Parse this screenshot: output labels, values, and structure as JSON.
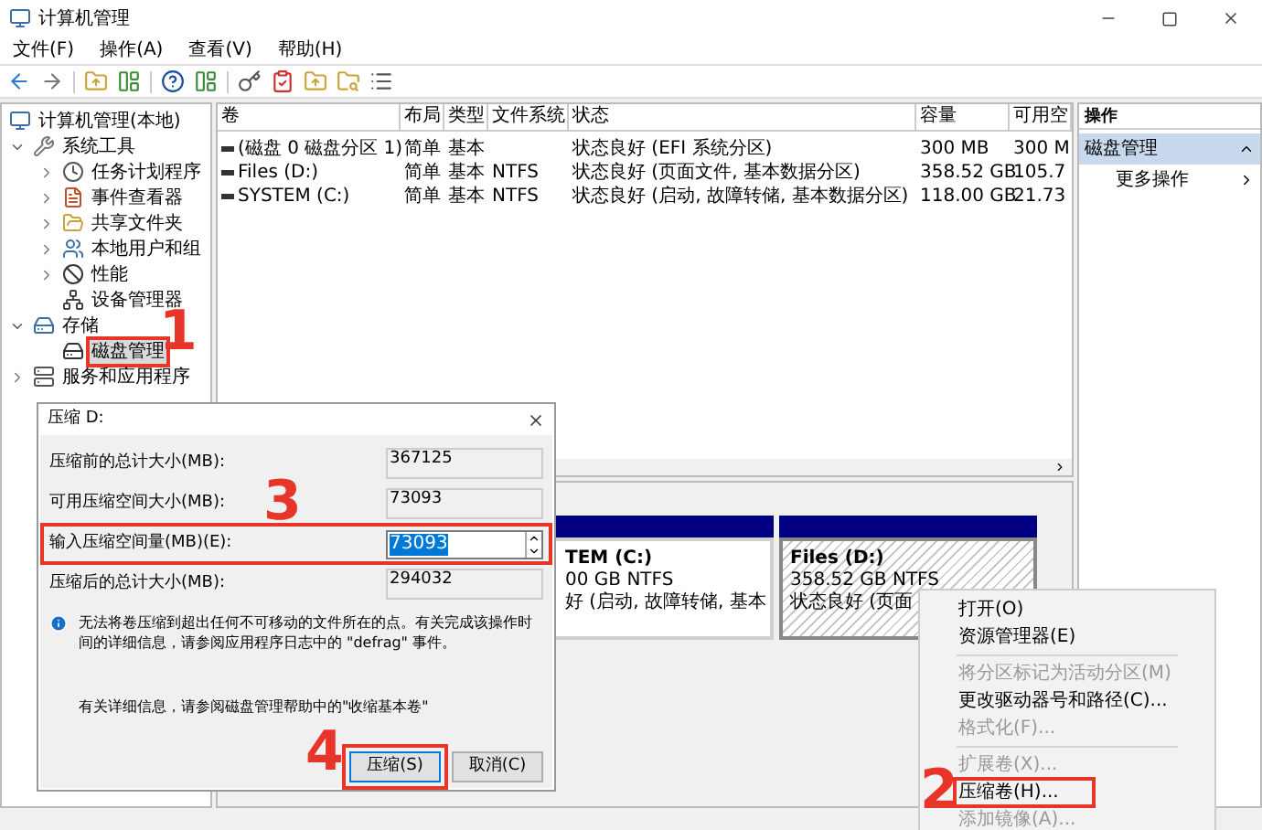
{
  "window": {
    "title": "计算机管理"
  },
  "menu": [
    "文件(F)",
    "操作(A)",
    "查看(V)",
    "帮助(H)"
  ],
  "tree": [
    {
      "label": "计算机管理(本地)",
      "selected": false,
      "children": [
        {
          "label": "系统工具",
          "selected": false,
          "expanded": true,
          "children": [
            {
              "label": "任务计划程序",
              "selected": false,
              "expanded": false
            },
            {
              "label": "事件查看器",
              "selected": false,
              "expanded": false
            },
            {
              "label": "共享文件夹",
              "selected": false,
              "expanded": false
            },
            {
              "label": "本地用户和组",
              "selected": false,
              "expanded": false
            },
            {
              "label": "性能",
              "selected": false,
              "expanded": false
            },
            {
              "label": "设备管理器",
              "selected": false
            }
          ]
        },
        {
          "label": "存储",
          "selected": false,
          "expanded": true,
          "children": [
            {
              "label": "磁盘管理",
              "selected": true,
              "step": "1"
            }
          ]
        },
        {
          "label": "服务和应用程序",
          "selected": false,
          "expanded": false
        }
      ]
    }
  ],
  "table": {
    "columns": [
      "卷",
      "布局",
      "类型",
      "文件系统",
      "状态",
      "容量",
      "可用空"
    ],
    "rows": [
      [
        "(磁盘 0 磁盘分区 1)",
        "简单",
        "基本",
        "",
        "状态良好 (EFI 系统分区)",
        "300 MB",
        "300 M"
      ],
      [
        "Files (D:)",
        "简单",
        "基本",
        "NTFS",
        "状态良好 (页面文件, 基本数据分区)",
        "358.52 GB",
        "105.7"
      ],
      [
        "SYSTEM (C:)",
        "简单",
        "基本",
        "NTFS",
        "状态良好 (启动, 故障转储, 基本数据分区)",
        "118.00 GB",
        "21.73"
      ]
    ]
  },
  "disk_map": {
    "partitions": [
      {
        "name": "TEM  (C:)",
        "size": "00 GB NTFS",
        "status": "好 (启动, 故障转储, 基本",
        "selected": false
      },
      {
        "name": "Files  (D:)",
        "size": "358.52 GB NTFS",
        "status": "状态良好 (页面",
        "selected": true
      }
    ]
  },
  "actions": {
    "title": "操作",
    "section": "磁盘管理",
    "items": [
      "更多操作"
    ]
  },
  "dialog": {
    "title": "压缩 D:",
    "fields": [
      {
        "label": "压缩前的总计大小(MB):",
        "value": "367125",
        "kind": "readonly"
      },
      {
        "label": "可用压缩空间大小(MB):",
        "value": "73093",
        "kind": "readonly"
      },
      {
        "label": "输入压缩空间量(MB)(E):",
        "value": "73093",
        "kind": "spin",
        "step": "3"
      },
      {
        "label": "压缩后的总计大小(MB):",
        "value": "294032",
        "kind": "readonly"
      }
    ],
    "info": "无法将卷压缩到超出任何不可移动的文件所在的点。有关完成该操作时间的详细信息，请参阅应用程序日志中的 \"defrag\" 事件。",
    "help": "有关详细信息，请参阅磁盘管理帮助中的\"收缩基本卷\"",
    "buttons": [
      {
        "label": "压缩(S)",
        "default": true,
        "step": "4"
      },
      {
        "label": "取消(C)",
        "default": false
      }
    ]
  },
  "context_menu": [
    [
      {
        "label": "打开(O)",
        "disabled": false
      },
      {
        "label": "资源管理器(E)",
        "disabled": false
      }
    ],
    [
      {
        "label": "将分区标记为活动分区(M)",
        "disabled": true
      },
      {
        "label": "更改驱动器号和路径(C)...",
        "disabled": false
      },
      {
        "label": "格式化(F)...",
        "disabled": true
      }
    ],
    [
      {
        "label": "扩展卷(X)...",
        "disabled": true
      },
      {
        "label": "压缩卷(H)...",
        "disabled": false,
        "step": "2"
      },
      {
        "label": "添加镜像(A)...",
        "disabled": true
      }
    ]
  ]
}
